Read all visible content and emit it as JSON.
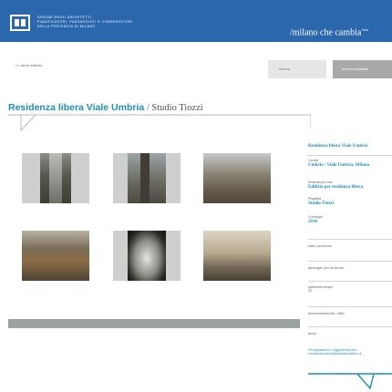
{
  "header": {
    "org_lines": [
      "ORDINE DEGLI ARCHITETTI",
      "PIANIFICATORI, PAESAGGISTI E CONSERVATORI",
      "DELLA PROVINCIA DI MILANO"
    ],
    "brand": "/milano che cambia",
    "brand_superscript": "beta",
    "bg_color": "#2a67ad"
  },
  "toolbar": {
    "back_label": "<< torna indietro",
    "search_placeholder": "ricerca",
    "search_button": "ricerca avanzata"
  },
  "project": {
    "name": "Residenza libera Viale Umbria",
    "separator": " / ",
    "studio": "Studio Tiozzi",
    "accent_color": "#1f8fb3"
  },
  "gallery": {
    "photos": [
      {
        "name": "construction-tower-photo"
      },
      {
        "name": "construction-crane-photo"
      },
      {
        "name": "construction-site-wide-photo"
      },
      {
        "name": "construction-foundation-photo"
      },
      {
        "name": "canopy-detail-photo"
      },
      {
        "name": "construction-pillars-photo"
      }
    ]
  },
  "sidebar": {
    "title": "Residenza libera Viale Umbria",
    "location_label": "Località",
    "location_value": "Umbria / Viale Umbria, Milano",
    "category_label": "Destinazione d'uso",
    "category_value": "Edilizia per residenza libera",
    "designer_label": "Progettisti",
    "designer_value": "Studio Tiozzi",
    "year_label": "Cronologia",
    "year_value": "2010",
    "filters": [
      "città: provincia",
      "tipologia: per funzione",
      "quartiere/municipio",
      "amministrazione: uffici",
      "anno"
    ],
    "filter_value": "ZD",
    "contact_lines": [
      "Per segnalazioni e suggerimenti scrivi",
      "a milanochecambia@ordinearchitetti.mi.it"
    ]
  }
}
